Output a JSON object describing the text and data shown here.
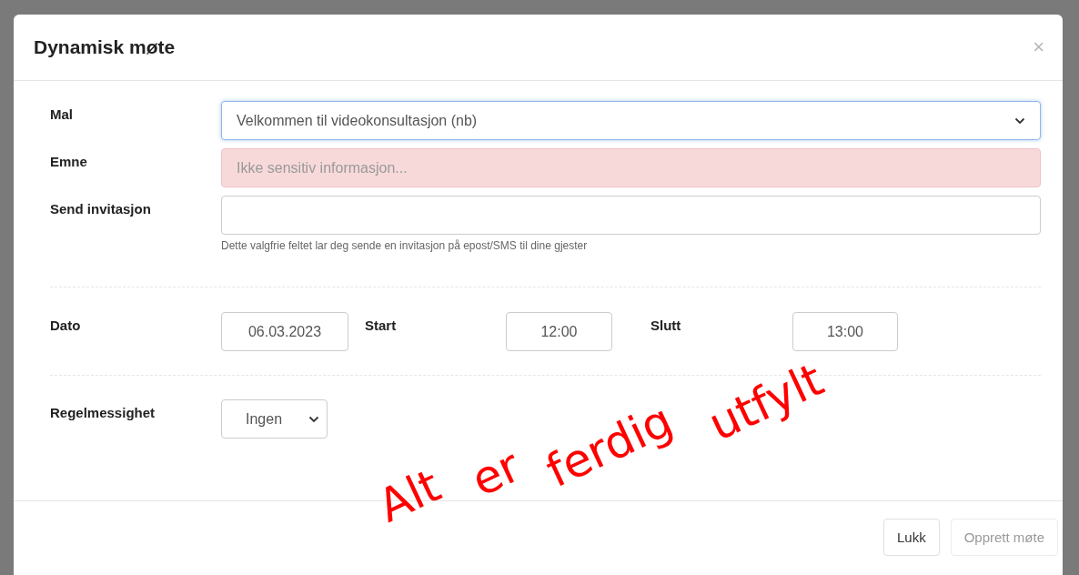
{
  "dialog": {
    "title": "Dynamisk møte",
    "close": "×"
  },
  "fields": [
    {
      "label": "Mal",
      "kind": "select",
      "value": "Velkommen til videokonsultasjon (nb)",
      "focused": true
    },
    {
      "label": "Emne",
      "kind": "text",
      "placeholder": "Ikke sensitiv informasjon...",
      "invalid": true
    },
    {
      "label": "Send invitasjon",
      "kind": "text",
      "help": "Dette valgfrie feltet lar deg sende en invitasjon på epost/SMS til dine gjester"
    }
  ],
  "schedule": [
    {
      "label": "Dato",
      "value": "06.03.2023"
    },
    {
      "label": "Start",
      "value": "12:00"
    },
    {
      "label": "Slutt",
      "value": "13:00"
    }
  ],
  "recurrence": {
    "label": "Regelmessighet",
    "value": "Ingen"
  },
  "buttons": [
    {
      "label": "Lukk",
      "disabled": false
    },
    {
      "label": "Opprett møte",
      "disabled": true
    }
  ],
  "annotation": {
    "words": [
      "Alt",
      "er",
      "ferdig",
      "utfylt"
    ]
  }
}
